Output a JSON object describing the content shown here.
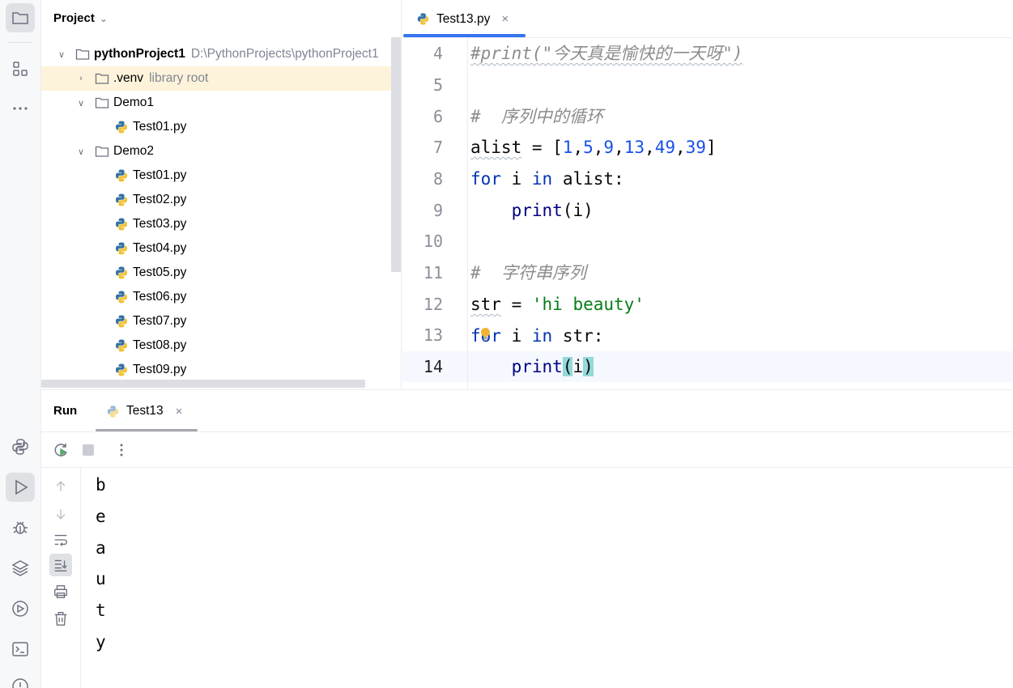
{
  "toolbar": {
    "items": [
      "project-icon",
      "structure-icon",
      "more-icon",
      "python-console-icon",
      "run-icon",
      "debug-icon",
      "layers-icon",
      "services-icon",
      "terminal-icon",
      "problems-icon"
    ]
  },
  "project": {
    "title": "Project",
    "tree": [
      {
        "label": "pythonProject1",
        "hint": "D:\\PythonProjects\\pythonProject1",
        "type": "folder",
        "expanded": true
      },
      {
        "label": ".venv",
        "hint": "library root",
        "type": "folder",
        "expanded": false,
        "selected": true
      },
      {
        "label": "Demo1",
        "type": "folder",
        "expanded": true
      },
      {
        "label": "Test01.py",
        "type": "python-file"
      },
      {
        "label": "Demo2",
        "type": "folder",
        "expanded": true
      },
      {
        "label": "Test01.py",
        "type": "python-file"
      },
      {
        "label": "Test02.py",
        "type": "python-file"
      },
      {
        "label": "Test03.py",
        "type": "python-file"
      },
      {
        "label": "Test04.py",
        "type": "python-file"
      },
      {
        "label": "Test05.py",
        "type": "python-file"
      },
      {
        "label": "Test06.py",
        "type": "python-file"
      },
      {
        "label": "Test07.py",
        "type": "python-file"
      },
      {
        "label": "Test08.py",
        "type": "python-file"
      },
      {
        "label": "Test09.py",
        "type": "python-file"
      }
    ]
  },
  "editor": {
    "tab": {
      "label": "Test13.py",
      "close": "×"
    },
    "line_numbers": [
      "4",
      "5",
      "6",
      "7",
      "8",
      "9",
      "10",
      "11",
      "12",
      "13",
      "14"
    ],
    "current_line": "14",
    "code": {
      "l4": "#print(\"今天真是愉快的一天呀\")",
      "l6": "#  序列中的循环",
      "l7_name": "alist",
      "l7_eq": " = [",
      "l7_n1": "1",
      "l7_n2": "5",
      "l7_n3": "9",
      "l7_n4": "13",
      "l7_n5": "49",
      "l7_n6": "39",
      "l7_comma": ",",
      "l7_close": "]",
      "l8_for": "for",
      "l8_mid": " i ",
      "l8_in": "in",
      "l8_rest": " alist:",
      "l9_indent": "    ",
      "l9_print": "print",
      "l9_rest": "(i)",
      "l11": "#  字符串序列",
      "l12_name": "str",
      "l12_eq": " = ",
      "l12_str": "'hi beauty'",
      "l13_for": "for",
      "l13_mid": " i ",
      "l13_in": "in",
      "l13_rest": " str:",
      "l14_indent": "    ",
      "l14_print": "print",
      "l14_open": "(",
      "l14_arg": "i",
      "l14_close": ")"
    }
  },
  "run": {
    "title": "Run",
    "tab": {
      "label": "Test13",
      "close": "×"
    },
    "output": [
      "b",
      "e",
      "a",
      "u",
      "t",
      "y"
    ]
  },
  "colors": {
    "accent": "#3574f0",
    "keyword": "#0033b3",
    "number": "#1750eb",
    "string": "#067d17",
    "comment": "#8c8c8c",
    "selected_row": "#fdf3da",
    "brace_highlight": "#93d9d9"
  }
}
